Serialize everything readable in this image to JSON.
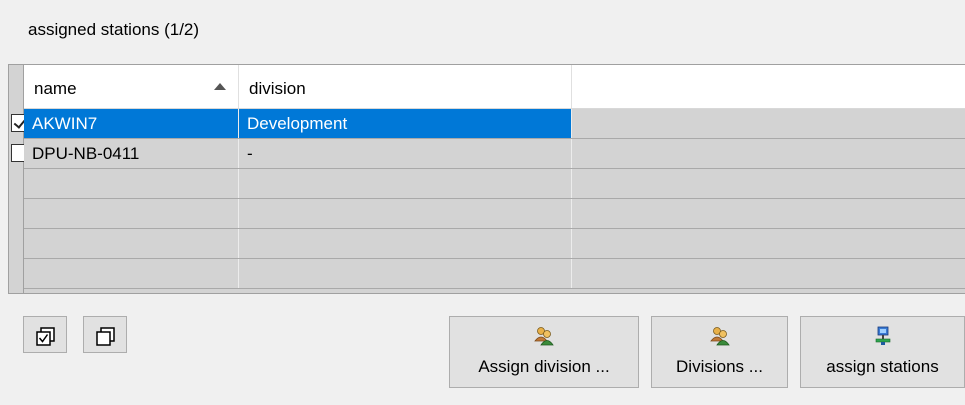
{
  "group_title": "assigned stations (1/2)",
  "grid": {
    "columns": [
      {
        "label": "name",
        "sort": "ascending"
      },
      {
        "label": "division"
      }
    ],
    "rows": [
      {
        "checked": true,
        "name": "AKWIN7",
        "division": "Development",
        "selected": true
      },
      {
        "checked": false,
        "name": "DPU-NB-0411",
        "division": "-",
        "selected": false
      }
    ],
    "empty_rows": 4
  },
  "toolbar": {
    "check_all_icon": "checkbox-check-all-icon",
    "uncheck_all_icon": "checkbox-uncheck-all-icon"
  },
  "buttons": {
    "assign_division": "Assign division ...",
    "divisions": "Divisions ...",
    "assign_stations": "assign stations"
  },
  "colors": {
    "selection": "#0078d7",
    "grid_background": "#d3d3d3",
    "window": "#f0f0f0"
  }
}
